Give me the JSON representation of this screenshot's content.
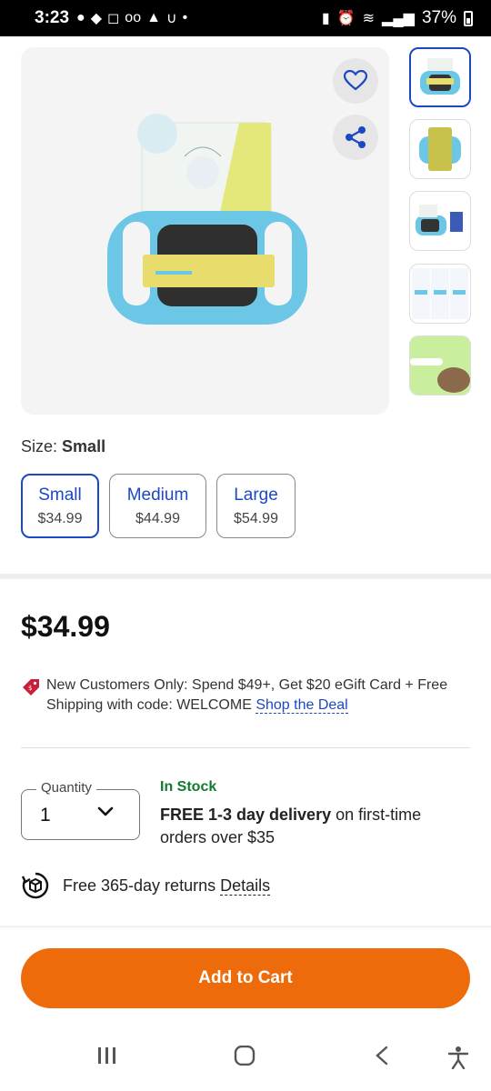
{
  "status_bar": {
    "time": "3:23",
    "battery": "37%"
  },
  "product_images": {
    "favorite_icon": "heart-icon",
    "share_icon": "share-icon",
    "thumbnail_count": 5,
    "active_thumbnail": 1
  },
  "size": {
    "label": "Size:",
    "selected": "Small",
    "options": [
      {
        "name": "Small",
        "price": "$34.99"
      },
      {
        "name": "Medium",
        "price": "$44.99"
      },
      {
        "name": "Large",
        "price": "$54.99"
      }
    ]
  },
  "price": "$34.99",
  "promo": {
    "text": "New Customers Only: Spend $49+, Get $20 eGift Card + Free Shipping with code: WELCOME",
    "link": "Shop the Deal"
  },
  "quantity": {
    "label": "Quantity",
    "value": "1"
  },
  "availability": {
    "stock": "In Stock",
    "delivery_bold": "FREE 1-3 day delivery",
    "delivery_rest": "on first-time orders over $35"
  },
  "returns": {
    "text": "Free 365-day returns",
    "link": "Details"
  },
  "cart_button": "Add to Cart",
  "colors": {
    "accent_blue": "#1c49c2",
    "cart_orange": "#ee6b0b",
    "stock_green": "#117a2e"
  }
}
